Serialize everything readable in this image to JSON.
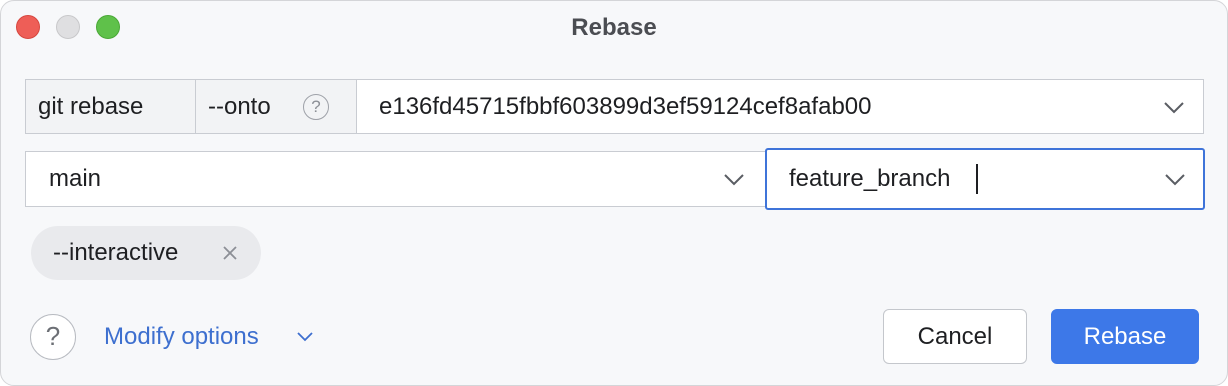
{
  "window": {
    "title": "Rebase"
  },
  "command": {
    "prefix": "git rebase",
    "onto_label": "--onto",
    "onto_help": "?",
    "onto_value": "e136fd45715fbbf603899d3ef59124cef8afab00",
    "upstream_value": "main",
    "branch_value": "feature_branch"
  },
  "options": {
    "chips": [
      {
        "label": "--interactive"
      }
    ]
  },
  "footer": {
    "help": "?",
    "modify_options": "Modify options",
    "cancel_label": "Cancel",
    "rebase_label": "Rebase"
  },
  "colors": {
    "accent": "#3d78e8",
    "link": "#3d6fcf",
    "focus_border": "#3f74d9"
  },
  "icons": {
    "close": "close-traffic-light",
    "minimize": "minimize-traffic-light",
    "zoom": "zoom-traffic-light",
    "dropdown": "chevron-down-icon",
    "remove": "close-icon",
    "help": "question-icon"
  }
}
